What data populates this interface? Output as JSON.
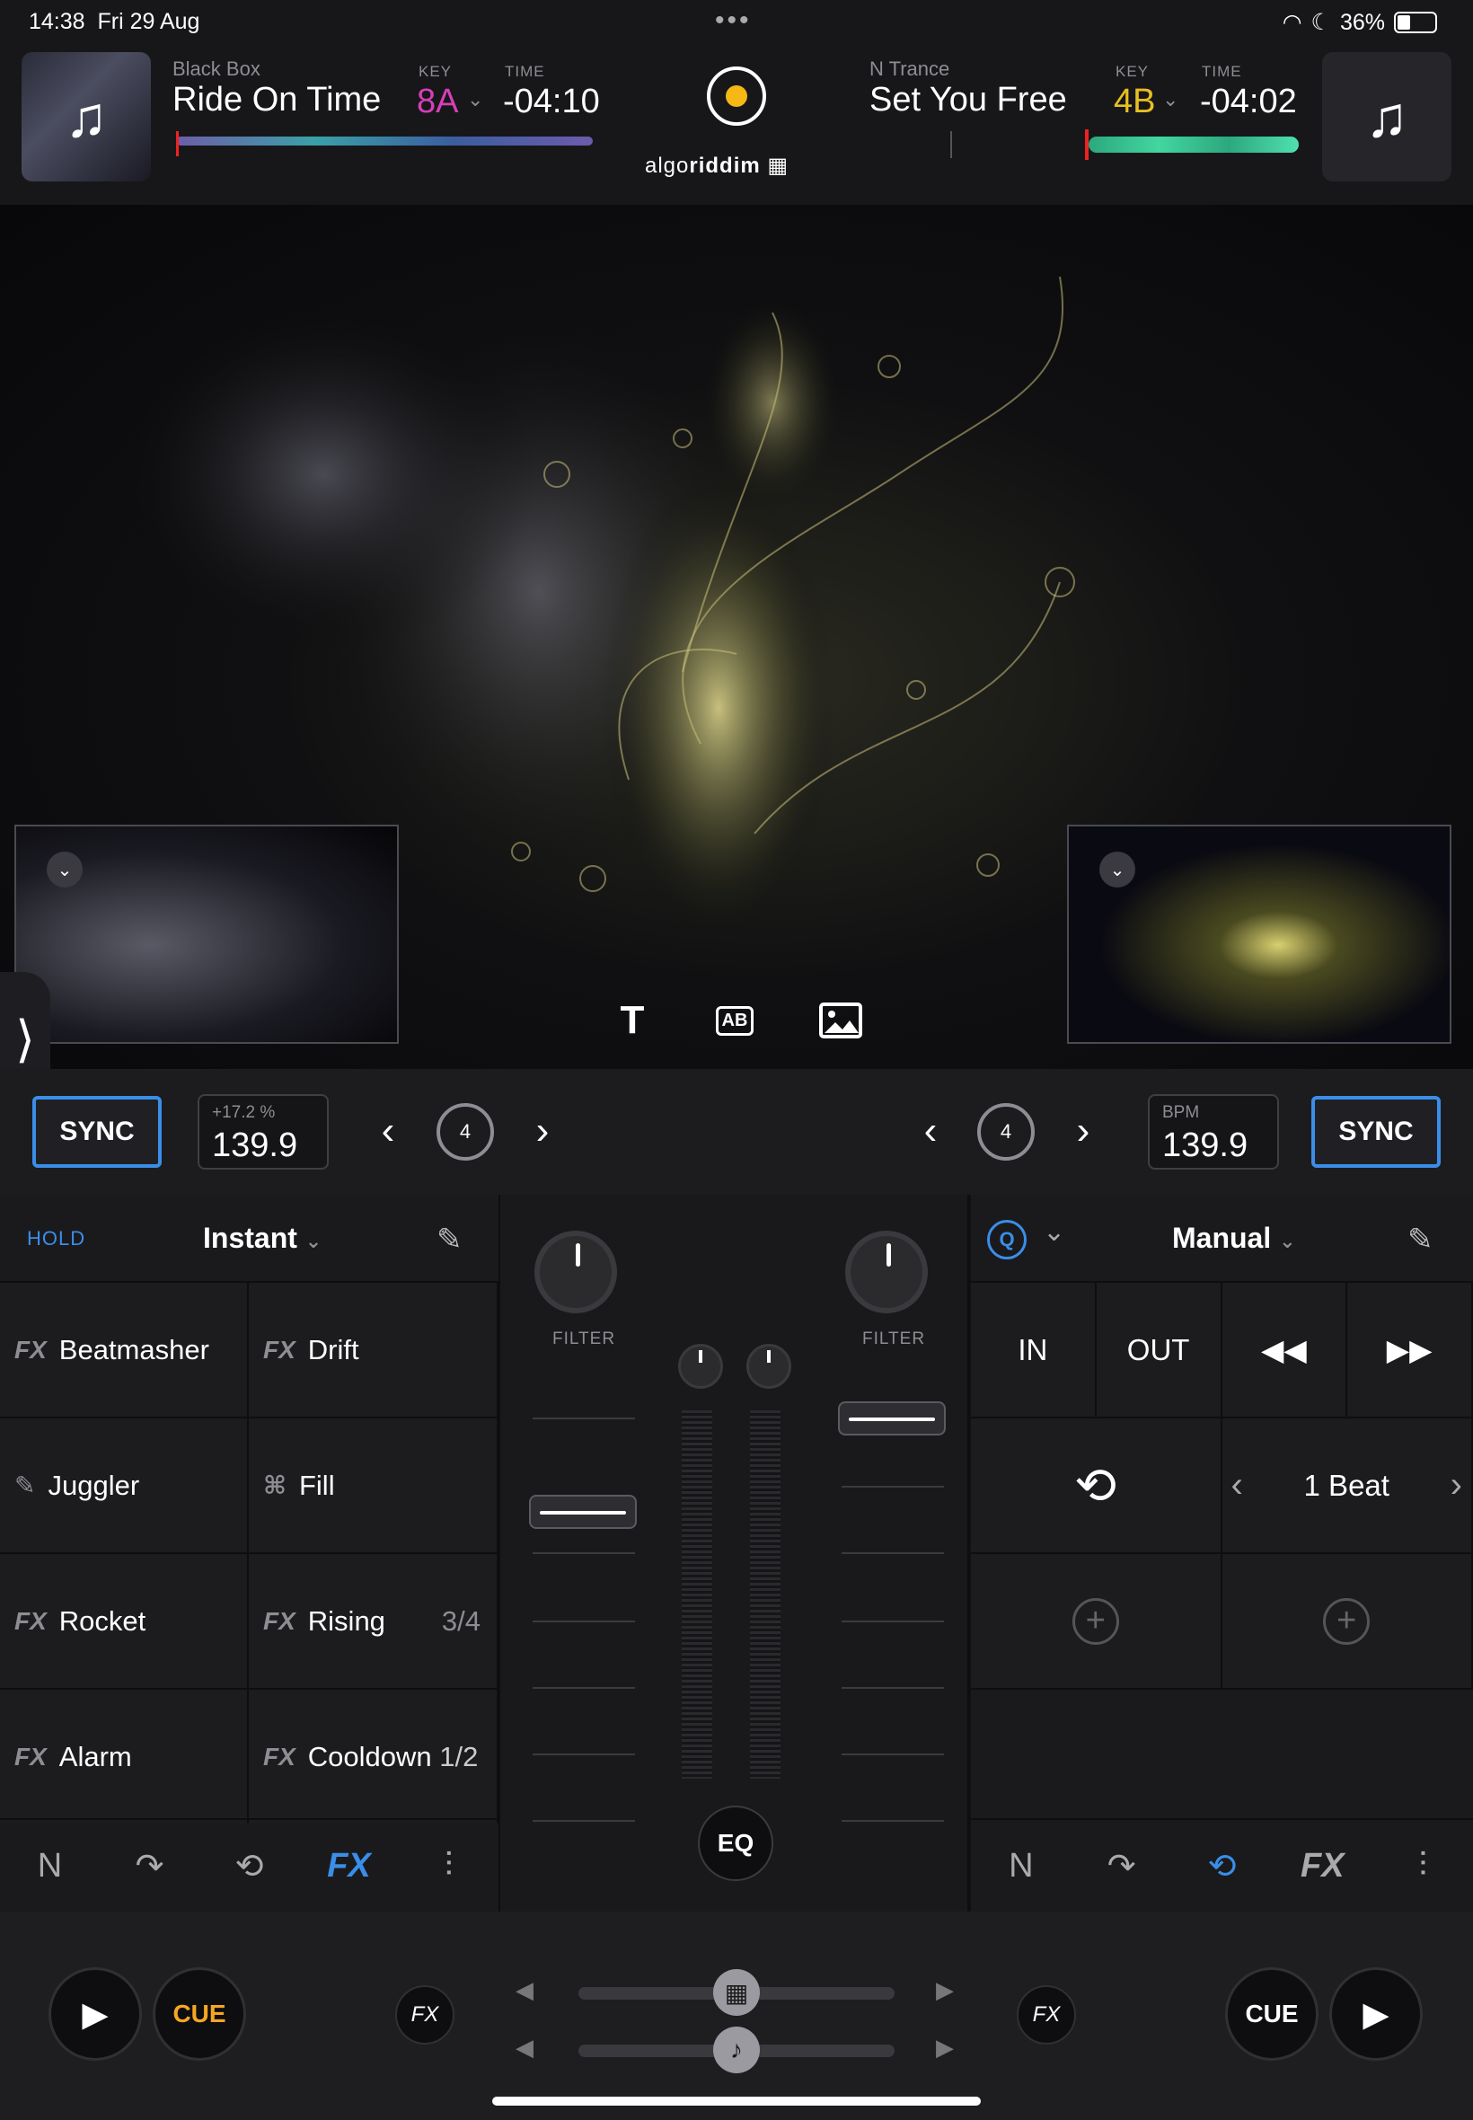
{
  "status": {
    "time": "14:38",
    "date": "Fri 29 Aug",
    "battery": "36%"
  },
  "deck_left": {
    "artist": "Black Box",
    "title": "Ride On Time",
    "key_label": "KEY",
    "key": "8A",
    "time_label": "TIME",
    "time": "-04:10",
    "key_color": "#d63fb8"
  },
  "deck_right": {
    "artist": "N Trance",
    "title": "Set You Free",
    "key_label": "KEY",
    "key": "4B",
    "time_label": "TIME",
    "time": "-04:02",
    "key_color": "#e8c020"
  },
  "brand": {
    "light": "algo",
    "bold": "riddim"
  },
  "transport_left": {
    "sync": "SYNC",
    "pitch": "+17.2 %",
    "bpm": "139.9",
    "loop": "4"
  },
  "transport_right": {
    "sync": "SYNC",
    "bpm_label": "BPM",
    "bpm": "139.9",
    "loop": "4"
  },
  "fx_panel": {
    "hold": "HOLD",
    "mode": "Instant",
    "cells": [
      {
        "prefix": "FX",
        "label": "Beatmasher",
        "suffix": ""
      },
      {
        "prefix": "FX",
        "label": "Drift",
        "suffix": ""
      },
      {
        "prefix": "✎",
        "label": "Juggler",
        "suffix": ""
      },
      {
        "prefix": "⌘",
        "label": "Fill",
        "suffix": ""
      },
      {
        "prefix": "FX",
        "label": "Rocket",
        "suffix": ""
      },
      {
        "prefix": "FX",
        "label": "Rising",
        "suffix": "3/4"
      },
      {
        "prefix": "FX",
        "label": "Alarm",
        "suffix": ""
      },
      {
        "prefix": "FX",
        "label": "Cooldown",
        "suffix": "1/2"
      }
    ]
  },
  "mixer": {
    "filter_left": "FILTER",
    "filter_right": "FILTER",
    "eq": "EQ"
  },
  "loop_panel": {
    "q": "Q",
    "mode": "Manual",
    "top": [
      "IN",
      "OUT",
      "◀◀",
      "▶▶"
    ],
    "beat": "1 Beat"
  },
  "bottom": {
    "cue_left": "CUE",
    "cue_right": "CUE",
    "fx": "FX"
  },
  "colors": {
    "accent_blue": "#3a8ee8",
    "cue_orange": "#f5a623"
  }
}
